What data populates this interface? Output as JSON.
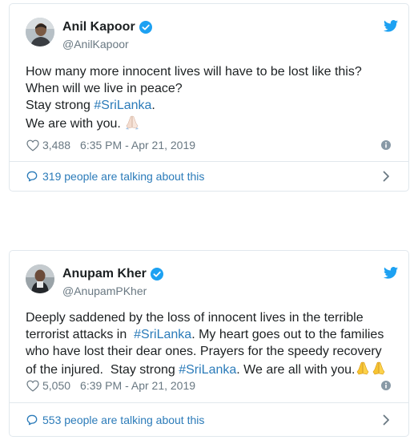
{
  "tweets": [
    {
      "author_name": "Anil Kapoor",
      "handle": "@AnilKapoor",
      "lines": [
        [
          {
            "t": "How many more innocent lives will have to be lost like this?"
          }
        ],
        [
          {
            "t": "When will we live in peace?"
          }
        ],
        [
          {
            "t": "Stay strong "
          },
          {
            "t": "#SriLanka",
            "tag": true
          },
          {
            "t": "."
          }
        ],
        [
          {
            "t": "We are with you. "
          },
          {
            "emoji": "folded-hands-light"
          }
        ]
      ],
      "likes": "3,488",
      "timestamp": "6:35 PM - Apr 21, 2019",
      "talking": "319 people are talking about this"
    },
    {
      "author_name": "Anupam Kher",
      "handle": "@AnupamPKher",
      "lines": [
        [
          {
            "t": "Deeply saddened by the loss of innocent lives in the terrible"
          }
        ],
        [
          {
            "t": "terrorist attacks in  "
          },
          {
            "t": "#SriLanka",
            "tag": true
          },
          {
            "t": ". My heart goes out to the families"
          }
        ],
        [
          {
            "t": "who have lost their dear ones. Prayers for the speedy recovery"
          }
        ],
        [
          {
            "t": "of the injured.  Stay strong "
          },
          {
            "t": "#SriLanka",
            "tag": true
          },
          {
            "t": ". We are all with you."
          },
          {
            "emoji": "folded-hands-yellow"
          },
          {
            "emoji": "folded-hands-yellow"
          }
        ]
      ],
      "likes": "5,050",
      "timestamp": "6:39 PM - Apr 21, 2019",
      "talking": "553 people are talking about this"
    }
  ],
  "colors": {
    "link": "#2b7bb9",
    "twitter_blue": "#1da1f2",
    "meta_gray": "#697882",
    "border": "#e1e8ed"
  },
  "icons": [
    "verified-icon",
    "twitter-bird-icon",
    "heart-icon",
    "info-icon",
    "speech-bubble-icon",
    "chevron-right-icon"
  ]
}
